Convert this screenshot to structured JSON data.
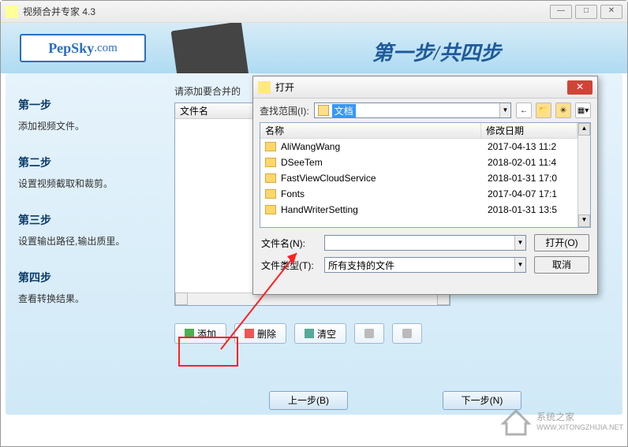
{
  "window": {
    "title": "视频合并专家 4.3"
  },
  "banner": {
    "logo_main": "PepSky",
    "logo_sub": ".com",
    "step_indicator": "第一步/共四步"
  },
  "sidebar": {
    "steps": [
      {
        "title": "第一步",
        "desc": "添加视频文件。"
      },
      {
        "title": "第二步",
        "desc": "设置视频截取和裁剪。"
      },
      {
        "title": "第三步",
        "desc": "设置输出路径,输出质里。"
      },
      {
        "title": "第四步",
        "desc": "查看转换结果。"
      }
    ]
  },
  "content": {
    "instruction": "请添加要合并的",
    "list_header": "文件名"
  },
  "toolbar": {
    "add": "添加",
    "delete": "删除",
    "clear": "清空"
  },
  "nav": {
    "prev": "上一步(B)",
    "next": "下一步(N)"
  },
  "open_dialog": {
    "title": "打开",
    "lookin_label": "查找范围(I):",
    "lookin_value": "文档",
    "columns": {
      "name": "名称",
      "date": "修改日期"
    },
    "rows": [
      {
        "name": "AliWangWang",
        "date": "2017-04-13 11:2"
      },
      {
        "name": "DSeeTem",
        "date": "2018-02-01 11:4"
      },
      {
        "name": "FastViewCloudService",
        "date": "2018-01-31 17:0"
      },
      {
        "name": "Fonts",
        "date": "2017-04-07 17:1"
      },
      {
        "name": "HandWriterSetting",
        "date": "2018-01-31 13:5"
      }
    ],
    "file_name_label": "文件名(N):",
    "file_type_label": "文件类型(T):",
    "file_type_value": "所有支持的文件",
    "open_btn": "打开(O)",
    "cancel_btn": "取消"
  },
  "watermark": {
    "line1": "系统之家",
    "line2": "WWW.XITONGZHIJIA.NET"
  }
}
